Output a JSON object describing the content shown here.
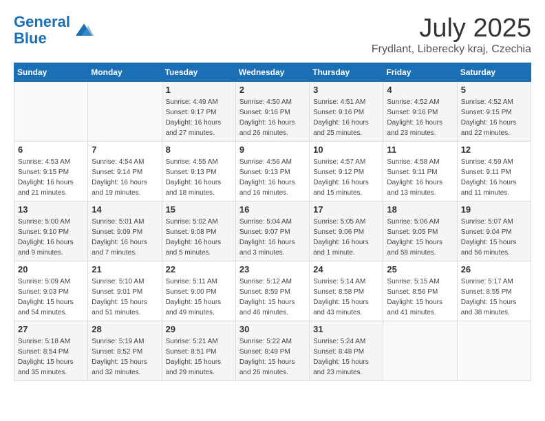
{
  "header": {
    "logo_line1": "General",
    "logo_line2": "Blue",
    "month": "July 2025",
    "location": "Frydlant, Liberecky kraj, Czechia"
  },
  "weekdays": [
    "Sunday",
    "Monday",
    "Tuesday",
    "Wednesday",
    "Thursday",
    "Friday",
    "Saturday"
  ],
  "weeks": [
    [
      {
        "day": "",
        "content": ""
      },
      {
        "day": "",
        "content": ""
      },
      {
        "day": "1",
        "content": "Sunrise: 4:49 AM\nSunset: 9:17 PM\nDaylight: 16 hours\nand 27 minutes."
      },
      {
        "day": "2",
        "content": "Sunrise: 4:50 AM\nSunset: 9:16 PM\nDaylight: 16 hours\nand 26 minutes."
      },
      {
        "day": "3",
        "content": "Sunrise: 4:51 AM\nSunset: 9:16 PM\nDaylight: 16 hours\nand 25 minutes."
      },
      {
        "day": "4",
        "content": "Sunrise: 4:52 AM\nSunset: 9:16 PM\nDaylight: 16 hours\nand 23 minutes."
      },
      {
        "day": "5",
        "content": "Sunrise: 4:52 AM\nSunset: 9:15 PM\nDaylight: 16 hours\nand 22 minutes."
      }
    ],
    [
      {
        "day": "6",
        "content": "Sunrise: 4:53 AM\nSunset: 9:15 PM\nDaylight: 16 hours\nand 21 minutes."
      },
      {
        "day": "7",
        "content": "Sunrise: 4:54 AM\nSunset: 9:14 PM\nDaylight: 16 hours\nand 19 minutes."
      },
      {
        "day": "8",
        "content": "Sunrise: 4:55 AM\nSunset: 9:13 PM\nDaylight: 16 hours\nand 18 minutes."
      },
      {
        "day": "9",
        "content": "Sunrise: 4:56 AM\nSunset: 9:13 PM\nDaylight: 16 hours\nand 16 minutes."
      },
      {
        "day": "10",
        "content": "Sunrise: 4:57 AM\nSunset: 9:12 PM\nDaylight: 16 hours\nand 15 minutes."
      },
      {
        "day": "11",
        "content": "Sunrise: 4:58 AM\nSunset: 9:11 PM\nDaylight: 16 hours\nand 13 minutes."
      },
      {
        "day": "12",
        "content": "Sunrise: 4:59 AM\nSunset: 9:11 PM\nDaylight: 16 hours\nand 11 minutes."
      }
    ],
    [
      {
        "day": "13",
        "content": "Sunrise: 5:00 AM\nSunset: 9:10 PM\nDaylight: 16 hours\nand 9 minutes."
      },
      {
        "day": "14",
        "content": "Sunrise: 5:01 AM\nSunset: 9:09 PM\nDaylight: 16 hours\nand 7 minutes."
      },
      {
        "day": "15",
        "content": "Sunrise: 5:02 AM\nSunset: 9:08 PM\nDaylight: 16 hours\nand 5 minutes."
      },
      {
        "day": "16",
        "content": "Sunrise: 5:04 AM\nSunset: 9:07 PM\nDaylight: 16 hours\nand 3 minutes."
      },
      {
        "day": "17",
        "content": "Sunrise: 5:05 AM\nSunset: 9:06 PM\nDaylight: 16 hours\nand 1 minute."
      },
      {
        "day": "18",
        "content": "Sunrise: 5:06 AM\nSunset: 9:05 PM\nDaylight: 15 hours\nand 58 minutes."
      },
      {
        "day": "19",
        "content": "Sunrise: 5:07 AM\nSunset: 9:04 PM\nDaylight: 15 hours\nand 56 minutes."
      }
    ],
    [
      {
        "day": "20",
        "content": "Sunrise: 5:09 AM\nSunset: 9:03 PM\nDaylight: 15 hours\nand 54 minutes."
      },
      {
        "day": "21",
        "content": "Sunrise: 5:10 AM\nSunset: 9:01 PM\nDaylight: 15 hours\nand 51 minutes."
      },
      {
        "day": "22",
        "content": "Sunrise: 5:11 AM\nSunset: 9:00 PM\nDaylight: 15 hours\nand 49 minutes."
      },
      {
        "day": "23",
        "content": "Sunrise: 5:12 AM\nSunset: 8:59 PM\nDaylight: 15 hours\nand 46 minutes."
      },
      {
        "day": "24",
        "content": "Sunrise: 5:14 AM\nSunset: 8:58 PM\nDaylight: 15 hours\nand 43 minutes."
      },
      {
        "day": "25",
        "content": "Sunrise: 5:15 AM\nSunset: 8:56 PM\nDaylight: 15 hours\nand 41 minutes."
      },
      {
        "day": "26",
        "content": "Sunrise: 5:17 AM\nSunset: 8:55 PM\nDaylight: 15 hours\nand 38 minutes."
      }
    ],
    [
      {
        "day": "27",
        "content": "Sunrise: 5:18 AM\nSunset: 8:54 PM\nDaylight: 15 hours\nand 35 minutes."
      },
      {
        "day": "28",
        "content": "Sunrise: 5:19 AM\nSunset: 8:52 PM\nDaylight: 15 hours\nand 32 minutes."
      },
      {
        "day": "29",
        "content": "Sunrise: 5:21 AM\nSunset: 8:51 PM\nDaylight: 15 hours\nand 29 minutes."
      },
      {
        "day": "30",
        "content": "Sunrise: 5:22 AM\nSunset: 8:49 PM\nDaylight: 15 hours\nand 26 minutes."
      },
      {
        "day": "31",
        "content": "Sunrise: 5:24 AM\nSunset: 8:48 PM\nDaylight: 15 hours\nand 23 minutes."
      },
      {
        "day": "",
        "content": ""
      },
      {
        "day": "",
        "content": ""
      }
    ]
  ]
}
